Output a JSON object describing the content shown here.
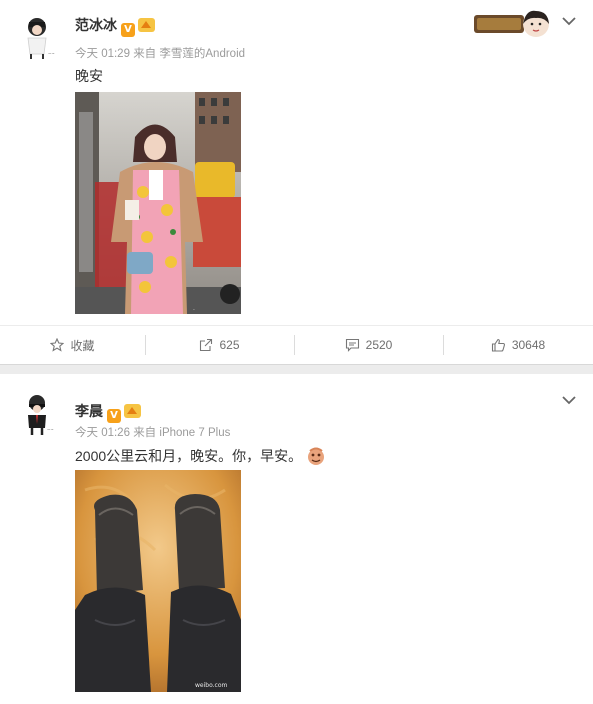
{
  "posts": [
    {
      "author": "范冰冰",
      "time": "今天 01:29",
      "source_prefix": "来自",
      "source": "李雪莲的Android",
      "text": "晚安",
      "actions": {
        "favorite_label": "收藏",
        "repost_count": "625",
        "comment_count": "2520",
        "like_count": "30648"
      }
    },
    {
      "author": "李晨",
      "time": "今天 01:26",
      "source_prefix": "来自",
      "source": "iPhone 7 Plus",
      "text": "2000公里云和月，晚安。你，早安。"
    }
  ],
  "icons": [
    "verified-v-icon",
    "member-crown-icon",
    "chevron-down-icon",
    "star-icon",
    "repost-icon",
    "comment-icon",
    "like-icon"
  ],
  "colors": {
    "verified": "#f7a11a",
    "accent_meta": "#9b9b9b",
    "divider": "#ececec"
  }
}
